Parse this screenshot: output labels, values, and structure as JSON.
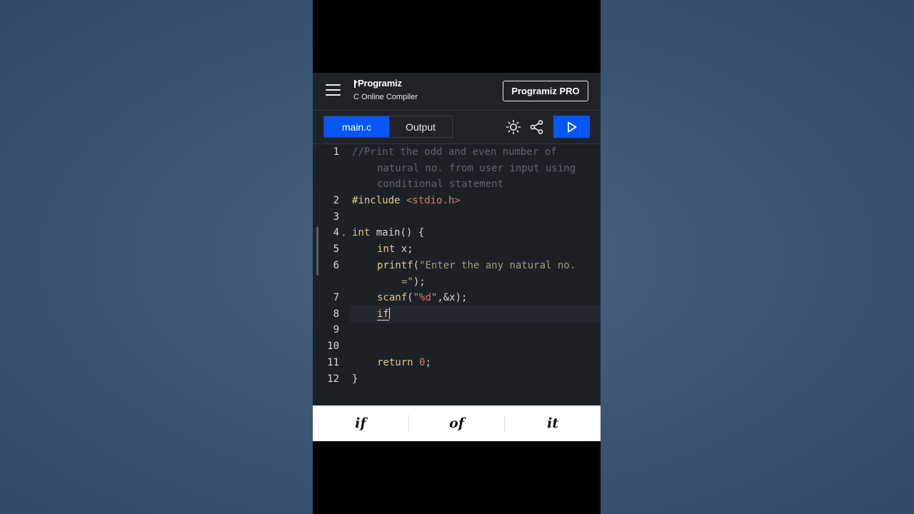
{
  "header": {
    "brand": "Programiz",
    "subtitle": "C Online Compiler",
    "pro_label": "Programiz PRO"
  },
  "toolbar": {
    "tabs": [
      {
        "label": "main.c",
        "active": true
      },
      {
        "label": "Output",
        "active": false
      }
    ],
    "icons": [
      "sun-icon",
      "share-icon",
      "play-icon"
    ]
  },
  "editor": {
    "line_numbers": [
      "1",
      "2",
      "3",
      "4",
      "5",
      "6",
      "7",
      "8",
      "9",
      "10",
      "11",
      "12"
    ],
    "lines": {
      "l1a": "//Print the odd and even number of",
      "l1b": "natural no. from user input using",
      "l1c": "conditional statement",
      "l2_directive": "#include ",
      "l2_header": "<stdio.h>",
      "l4_kw": "int",
      "l4_rest": " main() {",
      "l5_kw": "int",
      "l5_rest": " x;",
      "l6_fn": "printf",
      "l6_open": "(",
      "l6_str": "\"Enter the any natural no.",
      "l6b_str": "=\"",
      "l6b_rest": ");",
      "l7_fn": "scanf",
      "l7_open": "(",
      "l7_q1": "\"",
      "l7_fmt": "%d",
      "l7_q2": "\"",
      "l7_rest": ",&x);",
      "l8_kw": "if",
      "l11_kw": "return",
      "l11_num": "0",
      "l11_rest": ";",
      "l12": "}"
    }
  },
  "keyboard_suggestions": [
    "if",
    "of",
    "it"
  ],
  "colors": {
    "accent": "#0556f3",
    "editor_bg": "#1c2126",
    "header_bg": "#1f2327"
  }
}
